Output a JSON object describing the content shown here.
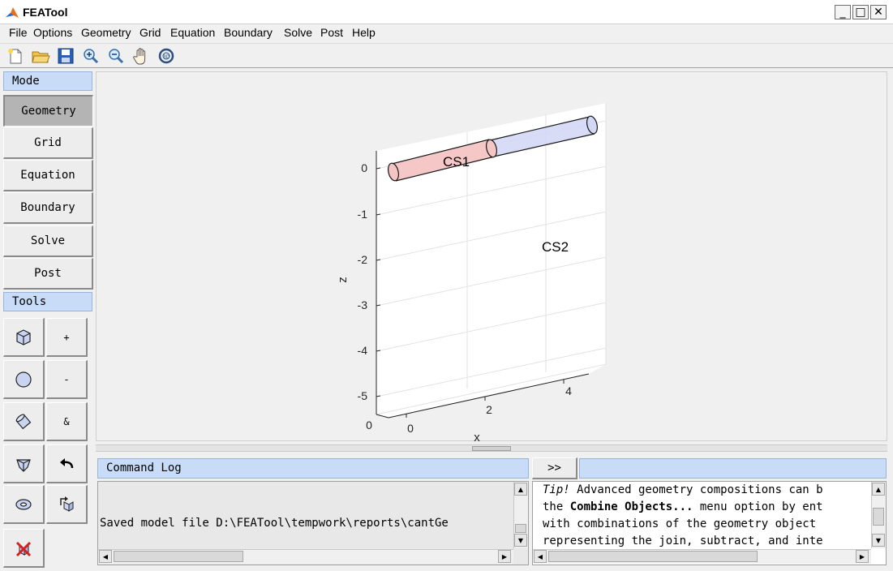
{
  "window": {
    "title": "FEATool",
    "controls": [
      "_",
      "□",
      "✕"
    ]
  },
  "menu": [
    "File",
    "Options",
    "Geometry",
    "Grid",
    "Equation",
    "Boundary",
    "Solve",
    "Post",
    "Help"
  ],
  "toolbar": [
    {
      "name": "new-file-icon"
    },
    {
      "name": "open-folder-icon"
    },
    {
      "name": "save-icon"
    },
    {
      "name": "zoom-in-icon"
    },
    {
      "name": "zoom-out-icon"
    },
    {
      "name": "pan-hand-icon"
    },
    {
      "name": "rotate-3d-icon"
    }
  ],
  "mode_panel": {
    "header": "Mode",
    "buttons": [
      "Geometry",
      "Grid",
      "Equation",
      "Boundary",
      "Solve",
      "Post"
    ],
    "active": "Geometry"
  },
  "tools_panel": {
    "header": "Tools",
    "buttons": [
      {
        "icon": "cube-icon",
        "label": ""
      },
      {
        "icon": "",
        "label": "+"
      },
      {
        "icon": "sphere-icon",
        "label": ""
      },
      {
        "icon": "",
        "label": "-"
      },
      {
        "icon": "cylinder-icon",
        "label": ""
      },
      {
        "icon": "",
        "label": "&"
      },
      {
        "icon": "cone-icon",
        "label": ""
      },
      {
        "icon": "undo-arrow-icon",
        "label": ""
      },
      {
        "icon": "torus-icon",
        "label": ""
      },
      {
        "icon": "transform-icon",
        "label": ""
      },
      {
        "icon": "delete-icon",
        "label": ""
      }
    ]
  },
  "plot": {
    "z_label": "z",
    "x_label": "x",
    "z_ticks": [
      "0",
      "-1",
      "-2",
      "-3",
      "-4",
      "-5"
    ],
    "x_ticks": [
      "0",
      "2",
      "4"
    ],
    "y_ticks": [
      "0"
    ],
    "objects": [
      {
        "label": "CS1",
        "color": "#f5c4c4"
      },
      {
        "label": "CS2",
        "color": "#d4d8f5"
      }
    ]
  },
  "command_log": {
    "header": "Command Log",
    "expand_label": ">>",
    "lines": [
      "Saved model file D:\\FEATool\\tempwork\\reports\\cantGe"
    ]
  },
  "tip": {
    "prefix": "Tip!",
    "line1": " Advanced geometry compositions can b",
    "line2_pre": "the ",
    "line2_bold": "Combine Objects...",
    "line2_post": " menu option by ent",
    "line3": "with combinations of the geometry object",
    "line4": "representing the join, subtract, and inte"
  }
}
